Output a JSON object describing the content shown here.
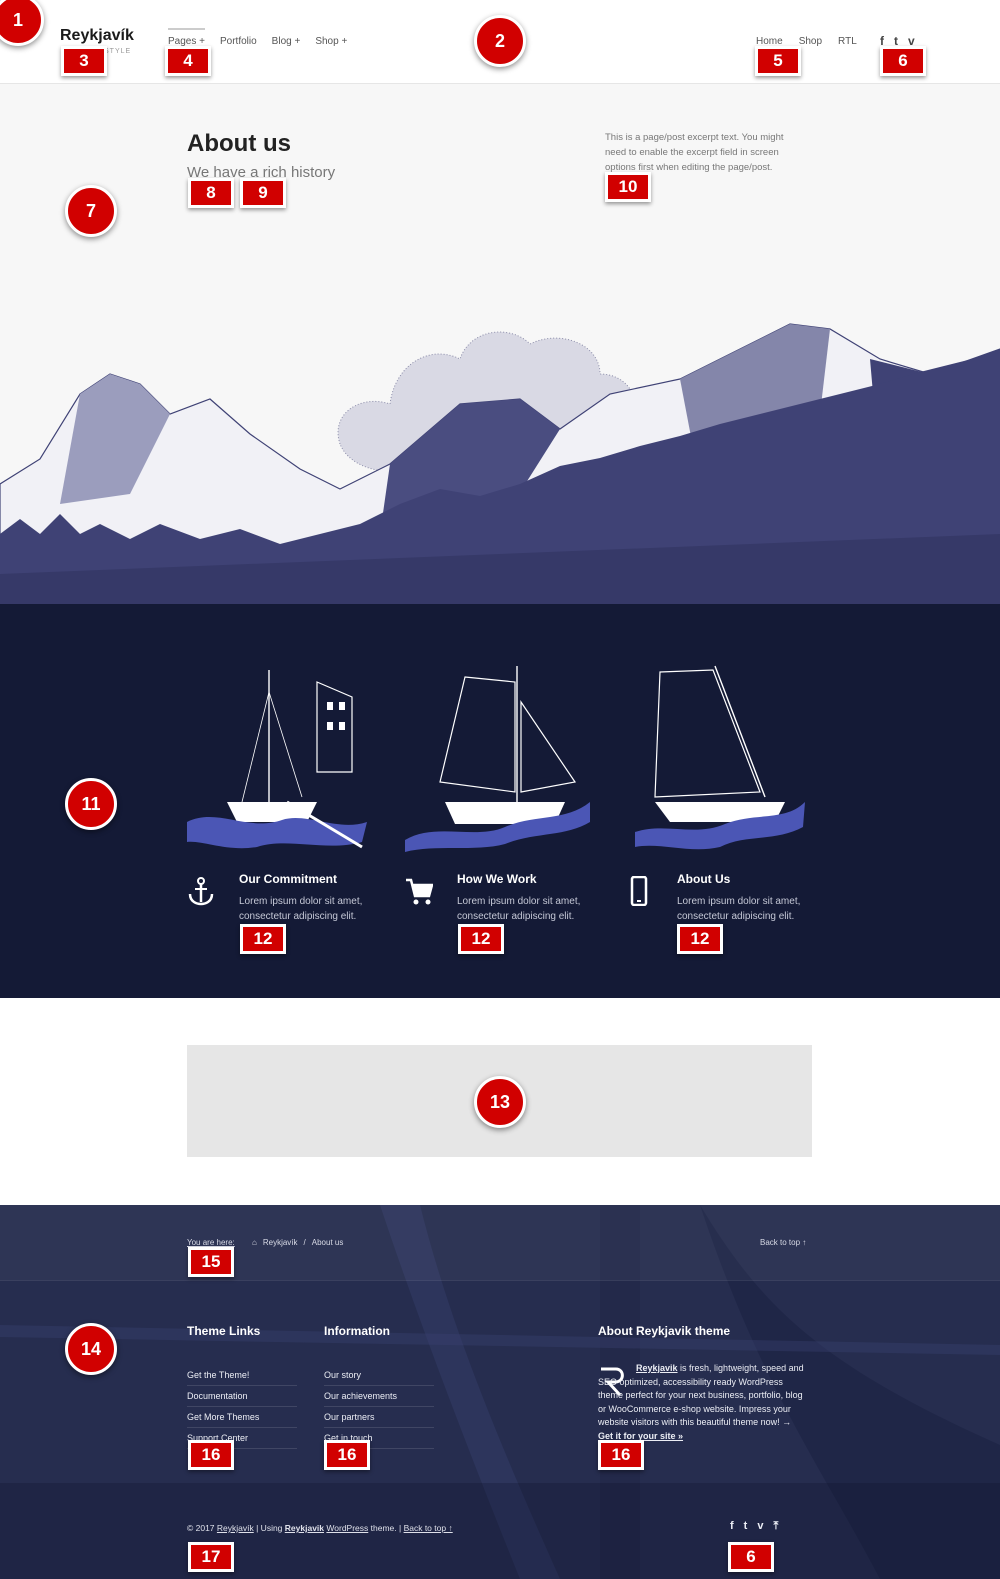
{
  "header": {
    "logo": "Reykjavík",
    "tagline": "STYLE",
    "main_nav": [
      "Pages +",
      "Portfolio",
      "Blog +",
      "Shop +"
    ],
    "secondary_nav": [
      "Home",
      "Shop",
      "RTL"
    ],
    "social_icons": [
      "facebook-icon",
      "twitter-icon",
      "vimeo-icon"
    ],
    "social_glyphs": [
      "f",
      "t",
      "v"
    ]
  },
  "hero": {
    "title": "About us",
    "subtitle": "We have a rich history",
    "excerpt": "This is a page/post excerpt text. You might need to enable the excerpt field in screen options first when editing the page/post."
  },
  "features": [
    {
      "icon": "anchor-icon",
      "title": "Our Commitment",
      "text": "Lorem ipsum dolor sit amet, consectetur adipiscing elit."
    },
    {
      "icon": "cart-icon",
      "title": "How We Work",
      "text": "Lorem ipsum dolor sit amet, consectetur adipiscing elit."
    },
    {
      "icon": "mobile-icon",
      "title": "About Us",
      "text": "Lorem ipsum dolor sit amet, consectetur adipiscing elit."
    }
  ],
  "breadcrumb": {
    "label": "You are here:",
    "home": "Reykjavík",
    "separator": "/",
    "current": "About us",
    "back_to_top": "Back to top ↑"
  },
  "footer": {
    "col1": {
      "title": "Theme Links",
      "links": [
        "Get the Theme!",
        "Documentation",
        "Get More Themes",
        "Support Center"
      ]
    },
    "col2": {
      "title": "Information",
      "links": [
        "Our story",
        "Our achievements",
        "Our partners",
        "Get in touch"
      ]
    },
    "about": {
      "title": "About Reykjavik theme",
      "name": "Reykjavik",
      "text": " is fresh, lightweight, speed and SEO optimized, accessibility ready WordPress theme perfect for your next business, portfolio, blog or WooCommerce e-shop website. Impress your website visitors with this beautiful theme now! → ",
      "link": "Get it for your site »"
    },
    "copyright": {
      "prefix": "© 2017 ",
      "site": "Reykjavík",
      "using": " | Using ",
      "theme": "Reykjavik",
      "wp": "WordPress",
      "suffix": " theme. | ",
      "back": "Back to top ↑"
    },
    "social_glyphs": [
      "f",
      "t",
      "v",
      "⤒"
    ]
  },
  "annotations": {
    "circles": [
      "1",
      "2",
      "7",
      "11",
      "13",
      "14"
    ],
    "squares": [
      "3",
      "4",
      "5",
      "6",
      "8",
      "9",
      "10",
      "12",
      "12",
      "12",
      "15",
      "16",
      "16",
      "16",
      "17",
      "6"
    ]
  },
  "colors": {
    "accent_red": "#d10000",
    "navy": "#141a36",
    "mountain_blue": "#3f4275",
    "wave_blue": "#4b56b5"
  }
}
